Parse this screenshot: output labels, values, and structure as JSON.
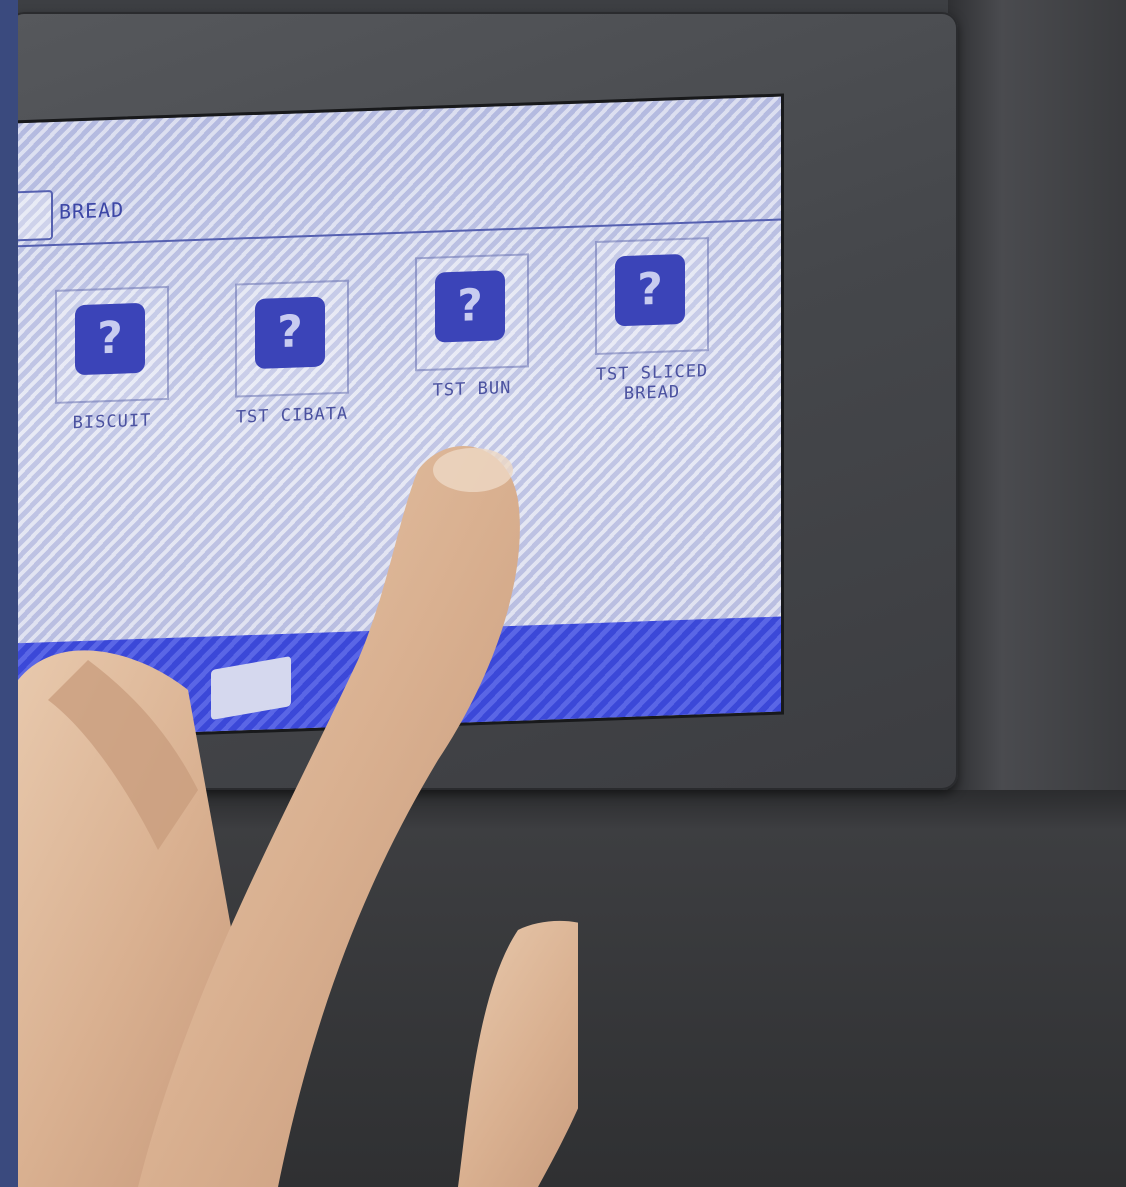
{
  "screen": {
    "header": {
      "label": "BREAD",
      "icon": "bread-icon"
    },
    "tiles": [
      {
        "label": "BISCUIT",
        "icon": "question-item-icon"
      },
      {
        "label": "TST CIBATA",
        "icon": "question-item-icon"
      },
      {
        "label": "TST BUN",
        "icon": "question-item-icon"
      },
      {
        "label": "TST SLICED BREAD",
        "icon": "question-item-icon"
      }
    ],
    "footer": {
      "icon": "back-icon"
    },
    "tile_icon_glyph": "?"
  },
  "colors": {
    "screen_bg": "#d0d4ec",
    "accent_blue": "#3b48d8",
    "text_blue": "#3c46a6",
    "frame_bg": "#3a4a7e"
  }
}
